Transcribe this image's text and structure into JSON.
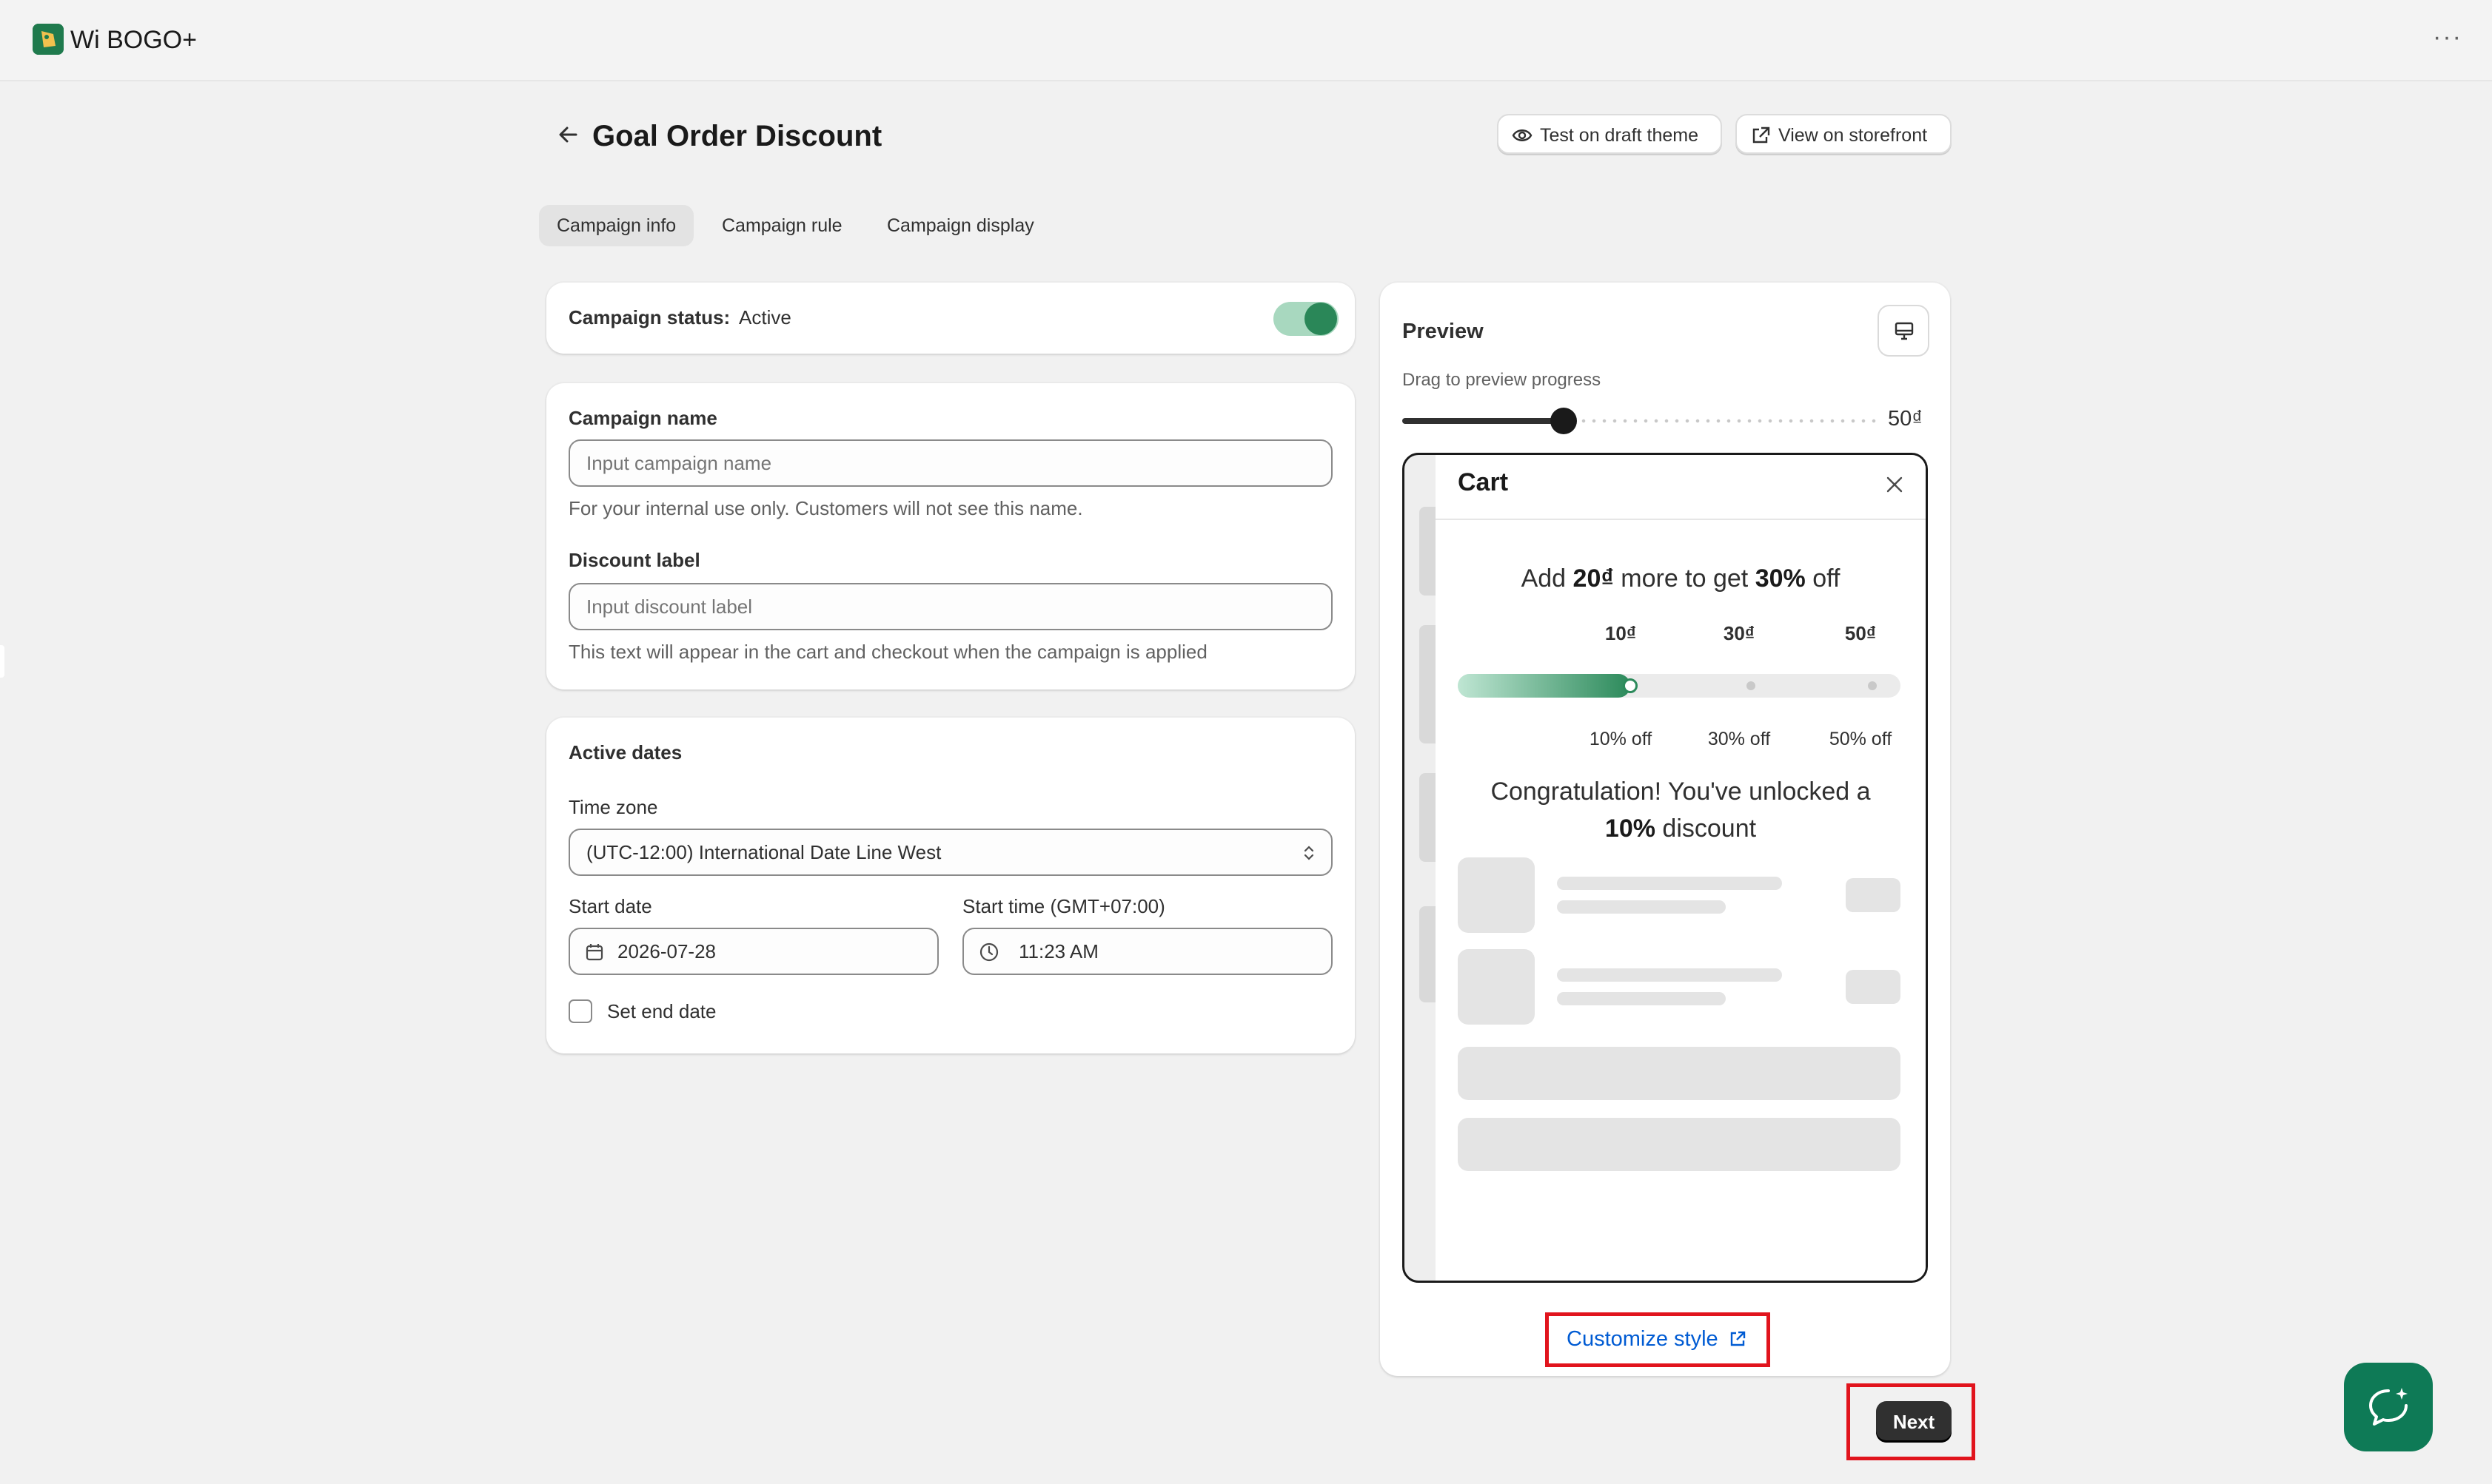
{
  "app": {
    "title": "Wi BOGO+",
    "menu_label": "···",
    "accent_color": "#1f7a4d"
  },
  "header": {
    "title": "Goal Order Discount",
    "test_draft_label": "Test on draft theme",
    "view_storefront_label": "View on storefront"
  },
  "tabs": [
    {
      "label": "Campaign info",
      "active": true
    },
    {
      "label": "Campaign rule",
      "active": false
    },
    {
      "label": "Campaign display",
      "active": false
    }
  ],
  "status_card": {
    "label": "Campaign status:",
    "value": "Active",
    "toggle_on": true
  },
  "name_card": {
    "campaign_name_label": "Campaign name",
    "campaign_name_placeholder": "Input campaign name",
    "campaign_name_help": "For your internal use only. Customers will not see this name.",
    "discount_label_label": "Discount label",
    "discount_label_placeholder": "Input discount label",
    "discount_label_help": "This text will appear in the cart and checkout when the campaign is applied"
  },
  "dates_card": {
    "title": "Active dates",
    "timezone_label": "Time zone",
    "timezone_value": "(UTC-12:00) International Date Line West",
    "start_date_label": "Start date",
    "start_date_value": "2026-07-28",
    "start_time_label": "Start time (GMT+07:00)",
    "start_time_value": "11:23 AM",
    "end_date_label": "Set end date",
    "end_date_checked": false
  },
  "preview": {
    "title": "Preview",
    "drag_hint": "Drag to preview progress",
    "slider_value": "50₫",
    "slider_fraction": 0.34,
    "cart": {
      "title": "Cart",
      "goal_prefix": "Add ",
      "goal_amount": "20₫",
      "goal_middle": " more to get ",
      "goal_percent": "30%",
      "goal_suffix": " off",
      "progress_fraction": 0.39,
      "tiers": [
        {
          "amount": "10₫",
          "discount": "10% off"
        },
        {
          "amount": "30₫",
          "discount": "30% off"
        },
        {
          "amount": "50₫",
          "discount": "50% off"
        }
      ],
      "congrats_prefix": "Congratulation! You've unlocked a",
      "congrats_percent": "10%",
      "congrats_suffix": " discount"
    },
    "customize_label": "Customize style"
  },
  "footer": {
    "next_label": "Next"
  }
}
